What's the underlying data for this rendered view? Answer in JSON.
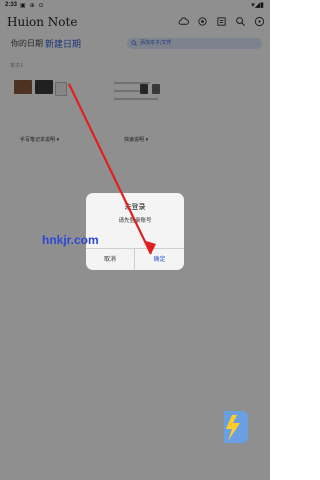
{
  "status_bar": {
    "time": "2:33",
    "notifications": "▣ ⊕ ⊙"
  },
  "app": {
    "title": "Huion Note"
  },
  "toolbar": {
    "icons": [
      "cloud-sync-icon",
      "settings-icon",
      "sort-icon",
      "search-icon",
      "more-icon"
    ]
  },
  "tabs": {
    "recent": "你的日期",
    "new": "新建日期"
  },
  "search": {
    "placeholder": "添加本子/文件"
  },
  "cards": [
    {
      "title": "本子1",
      "label": "手写笔记本说明 ▾"
    },
    {
      "title": "",
      "label": "快速说明 ▾"
    }
  ],
  "dialog": {
    "title": "未登录",
    "message": "请先登录账号",
    "cancel_label": "取消",
    "confirm_label": "确定"
  },
  "watermark": {
    "text": "hnkjr.com"
  },
  "colors": {
    "accent": "#2d5fd3",
    "arrow": "#e02020",
    "overlay": "rgba(0,0,0,0.44)"
  }
}
